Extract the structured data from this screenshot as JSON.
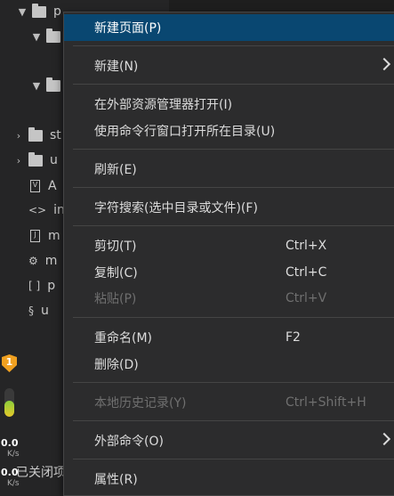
{
  "explorer": {
    "rows": [
      {
        "label": "p",
        "icon": "folder-icon",
        "expanded": true
      },
      {
        "label": "",
        "icon": "folder-icon",
        "expanded": true
      },
      {
        "label": "",
        "icon": "folder-icon",
        "expanded": true
      },
      {
        "label": "st",
        "icon": "folder-icon",
        "expanded": false
      },
      {
        "label": "u",
        "icon": "folder-icon",
        "expanded": false
      },
      {
        "label": "A",
        "icon": "vue-file-icon",
        "glyph": "V"
      },
      {
        "label": "in",
        "icon": "html-file-icon",
        "glyph": "<>"
      },
      {
        "label": "m",
        "icon": "js-file-icon",
        "glyph": "J"
      },
      {
        "label": "m",
        "icon": "settings-file-icon",
        "glyph": "⚙"
      },
      {
        "label": "p",
        "icon": "json-file-icon",
        "glyph": "[ ]"
      },
      {
        "label": "u",
        "icon": "link-file-icon",
        "glyph": "§"
      }
    ],
    "bottom_text": "已关闭项"
  },
  "network_widget": {
    "shield_glyph": "1",
    "meter_level": 0.55,
    "upload_value": "0.0",
    "upload_unit": "K/s",
    "download_value": "0.0",
    "download_unit": "K/s"
  },
  "context_menu": {
    "items": [
      {
        "label": "新建页面(P)",
        "shortcut": "",
        "submenu": false,
        "disabled": false,
        "selected": true
      },
      {
        "label": "新建(N)",
        "shortcut": "",
        "submenu": true,
        "disabled": false,
        "selected": false
      },
      {
        "label": "在外部资源管理器打开(I)",
        "shortcut": "",
        "submenu": false,
        "disabled": false,
        "selected": false
      },
      {
        "label": "使用命令行窗口打开所在目录(U)",
        "shortcut": "",
        "submenu": false,
        "disabled": false,
        "selected": false
      },
      {
        "label": "刷新(E)",
        "shortcut": "",
        "submenu": false,
        "disabled": false,
        "selected": false
      },
      {
        "label": "字符搜索(选中目录或文件)(F)",
        "shortcut": "",
        "submenu": false,
        "disabled": false,
        "selected": false
      },
      {
        "label": "剪切(T)",
        "shortcut": "Ctrl+X",
        "submenu": false,
        "disabled": false,
        "selected": false
      },
      {
        "label": "复制(C)",
        "shortcut": "Ctrl+C",
        "submenu": false,
        "disabled": false,
        "selected": false
      },
      {
        "label": "粘贴(P)",
        "shortcut": "Ctrl+V",
        "submenu": false,
        "disabled": true,
        "selected": false
      },
      {
        "label": "重命名(M)",
        "shortcut": "F2",
        "submenu": false,
        "disabled": false,
        "selected": false
      },
      {
        "label": "删除(D)",
        "shortcut": "",
        "submenu": false,
        "disabled": false,
        "selected": false
      },
      {
        "label": "本地历史记录(Y)",
        "shortcut": "Ctrl+Shift+H",
        "submenu": false,
        "disabled": true,
        "selected": false
      },
      {
        "label": "外部命令(O)",
        "shortcut": "",
        "submenu": true,
        "disabled": false,
        "selected": false
      },
      {
        "label": "属性(R)",
        "shortcut": "",
        "submenu": false,
        "disabled": false,
        "selected": false
      }
    ]
  },
  "colors": {
    "menu_background": "#2c2c2d",
    "selection": "#094771",
    "disabled_text": "#6f6f6f",
    "shield": "#f0a020"
  }
}
